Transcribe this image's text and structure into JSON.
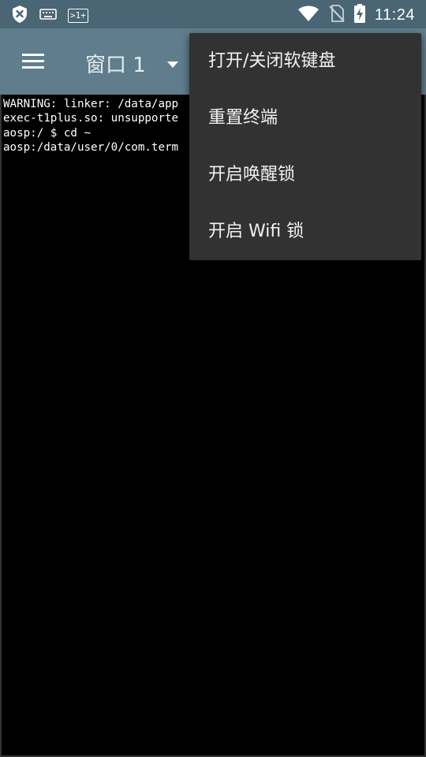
{
  "status_bar": {
    "time": "11:24",
    "left_icons": [
      "shield-x-icon",
      "keyboard-icon",
      "terminal-badge-icon"
    ],
    "right_icons": [
      "wifi-icon",
      "no-sim-icon",
      "battery-charging-icon"
    ],
    "terminal_badge_text": ">1+"
  },
  "app_bar": {
    "window_title": "窗口 1",
    "menu_icon": "hamburger-icon",
    "dropdown_icon": "caret-down-icon"
  },
  "terminal": {
    "lines": [
      "WARNING: linker: /data/app",
      "exec-t1plus.so: unsupporte",
      "aosp:/ $ cd ~",
      "aosp:/data/user/0/com.term"
    ]
  },
  "menu": {
    "items": [
      "打开/关闭软键盘",
      "重置终端",
      "开启唤醒锁",
      "开启 Wifi 锁"
    ]
  },
  "colors": {
    "status_bar": "#4a6573",
    "app_bar": "#5f7d8c",
    "menu_bg": "#323232",
    "terminal_bg": "#000000",
    "terminal_text": "#ffffff"
  }
}
